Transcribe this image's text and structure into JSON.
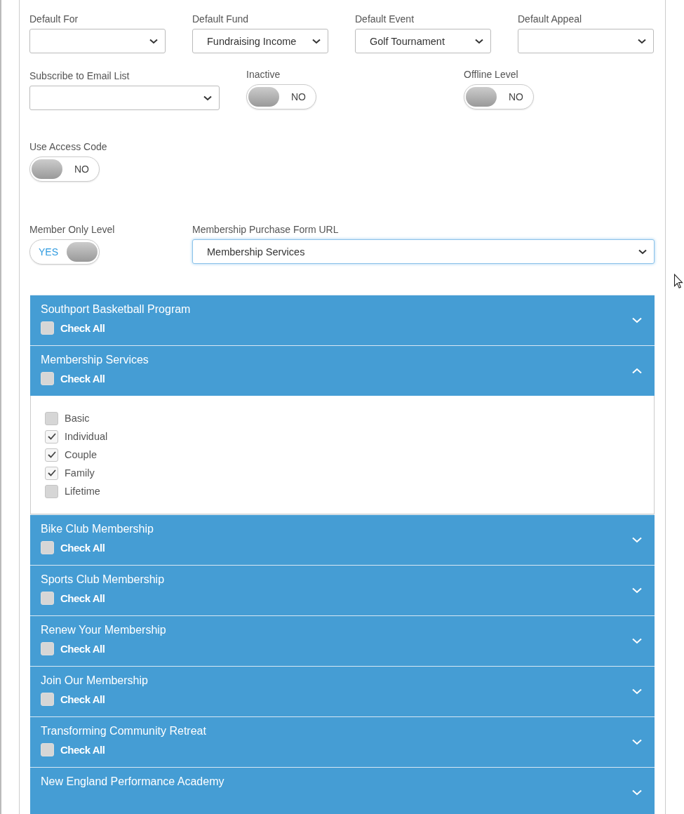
{
  "defaults": [
    {
      "label": "Default For"
    },
    {
      "label": "Default Fund",
      "value": "Fundraising Income"
    },
    {
      "label": "Default Event",
      "value": "Golf Tournament"
    },
    {
      "label": "Default Appeal"
    }
  ],
  "subscribe": {
    "label": "Subscribe to Email List"
  },
  "inactive": {
    "label": "Inactive",
    "on": false,
    "text": "NO"
  },
  "offline_level": {
    "label": "Offline Level",
    "on": false,
    "text": "NO"
  },
  "use_access_code": {
    "label": "Use Access Code",
    "on": false,
    "text": "NO"
  },
  "member_only_level": {
    "label": "Member Only Level",
    "on": true,
    "text": "YES"
  },
  "purchase_form_url": {
    "label": "Membership Purchase Form URL",
    "value": "Membership Services",
    "focused": true
  },
  "panels": [
    {
      "title": "Southport Basketball Program",
      "check_all": {
        "label": "Check All",
        "checked": false
      },
      "expanded": false
    },
    {
      "title": "Membership Services",
      "check_all": {
        "label": "Check All",
        "checked": false
      },
      "expanded": true,
      "items": [
        {
          "label": "Basic",
          "checked": false
        },
        {
          "label": "Individual",
          "checked": true
        },
        {
          "label": "Couple",
          "checked": true
        },
        {
          "label": "Family",
          "checked": true
        },
        {
          "label": "Lifetime",
          "checked": false
        }
      ]
    },
    {
      "title": "Bike Club Membership",
      "check_all": {
        "label": "Check All",
        "checked": false
      },
      "expanded": false
    },
    {
      "title": "Sports Club Membership",
      "check_all": {
        "label": "Check All",
        "checked": false
      },
      "expanded": false
    },
    {
      "title": "Renew Your Membership",
      "check_all": {
        "label": "Check All",
        "checked": false
      },
      "expanded": false
    },
    {
      "title": "Join Our Membership",
      "check_all": {
        "label": "Check All",
        "checked": false
      },
      "expanded": false
    },
    {
      "title": "Transforming Community Retreat",
      "check_all": {
        "label": "Check All",
        "checked": false
      },
      "expanded": false
    },
    {
      "title": "New England Performance Academy",
      "expanded": false
    }
  ]
}
